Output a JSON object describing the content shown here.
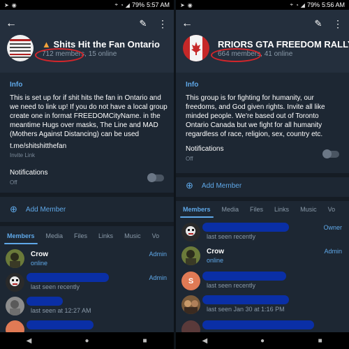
{
  "left": {
    "status": {
      "time": "5:57 AM",
      "battery": "79%"
    },
    "group": {
      "title": "Shits Hit the Fan Ontario",
      "subtitle": "712 members, 15 online"
    },
    "info": {
      "heading": "Info",
      "description": "This is set up for if shit hits the fan in Ontario and we need to link up! If you do not have a local group create one in format FREEDOMCityName. in the meantime Hugs over masks, The Line and MAD (Mothers Against Distancing) can be used",
      "link": "t.me/shitshitthefan",
      "link_label": "Invite Link"
    },
    "notifications": {
      "label": "Notifications",
      "value": "Off"
    },
    "add_member": "Add Member",
    "tabs": [
      "Members",
      "Media",
      "Files",
      "Links",
      "Music",
      "Vo"
    ],
    "members": [
      {
        "name": "Crow",
        "status": "online",
        "role": "Admin"
      },
      {
        "name": "",
        "status": "last seen recently",
        "role": "Admin"
      },
      {
        "name": "",
        "status": "last seen at 12:27 AM",
        "role": ""
      },
      {
        "name": "",
        "status": "",
        "role": ""
      }
    ]
  },
  "right": {
    "status": {
      "time": "5:56 AM",
      "battery": "79%"
    },
    "group": {
      "title": "RRIORS   GTA FREEDOM RALLY W",
      "subtitle": "664 members, 41 online"
    },
    "info": {
      "heading": "Info",
      "description": "This group is for fighting for humanity, our freedoms, and God given rights. Invite all like minded people. We're based out of Toronto Ontario Canada but we fight for all humanity regardless of race, religion, sex, country etc."
    },
    "notifications": {
      "label": "Notifications",
      "value": "Off"
    },
    "add_member": "Add Member",
    "tabs": [
      "Members",
      "Media",
      "Files",
      "Links",
      "Music",
      "Vo"
    ],
    "members": [
      {
        "name": "",
        "status": "last seen recently",
        "role": "Owner"
      },
      {
        "name": "Crow",
        "status": "online",
        "role": "Admin"
      },
      {
        "name": "",
        "status": "last seen recently",
        "role": "",
        "initial": "S"
      },
      {
        "name": "",
        "status": "last seen Jan 30 at 1:16 PM",
        "role": ""
      },
      {
        "name": "",
        "status": "",
        "role": ""
      }
    ]
  },
  "colors": {
    "accent": "#5fa8e8",
    "header": "#242f3d",
    "background": "#1d2733",
    "redaction": "#0a2fa6",
    "highlight": "#d3262b"
  }
}
